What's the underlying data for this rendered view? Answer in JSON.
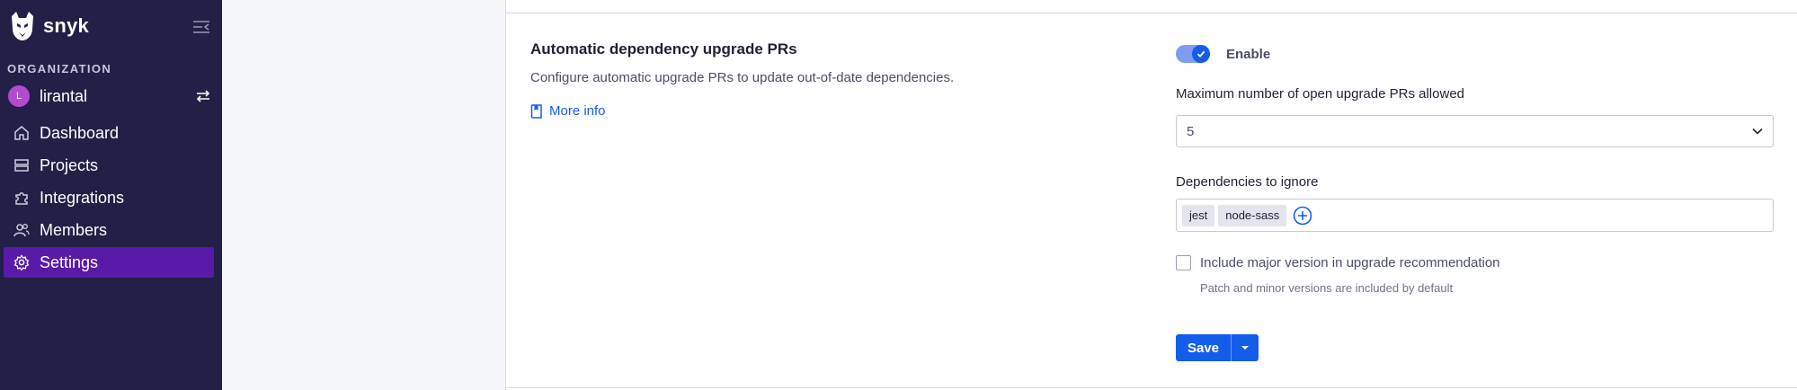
{
  "sidebar": {
    "brand": "snyk",
    "org_section_label": "ORGANIZATION",
    "org_avatar_letter": "L",
    "org_name": "lirantal",
    "items": [
      {
        "label": "Dashboard",
        "icon": "home-icon",
        "active": false
      },
      {
        "label": "Projects",
        "icon": "stack-icon",
        "active": false
      },
      {
        "label": "Integrations",
        "icon": "puzzle-icon",
        "active": false
      },
      {
        "label": "Members",
        "icon": "people-icon",
        "active": false
      },
      {
        "label": "Settings",
        "icon": "gear-icon",
        "active": true
      }
    ]
  },
  "section": {
    "title": "Automatic dependency upgrade PRs",
    "description": "Configure automatic upgrade PRs to update out-of-date dependencies.",
    "more_info": "More info"
  },
  "form": {
    "enable_label": "Enable",
    "enabled": true,
    "max_prs_label": "Maximum number of open upgrade PRs allowed",
    "max_prs_value": "5",
    "ignore_label": "Dependencies to ignore",
    "ignore_tags": [
      "jest",
      "node-sass"
    ],
    "major_version_label": "Include major version in upgrade recommendation",
    "major_version_checked": false,
    "major_version_hint": "Patch and minor versions are included by default",
    "save_label": "Save"
  },
  "colors": {
    "sidebar_bg": "#231f46",
    "active_nav": "#5a1aa8",
    "accent_blue": "#145deb",
    "avatar": "#b34bd0"
  }
}
